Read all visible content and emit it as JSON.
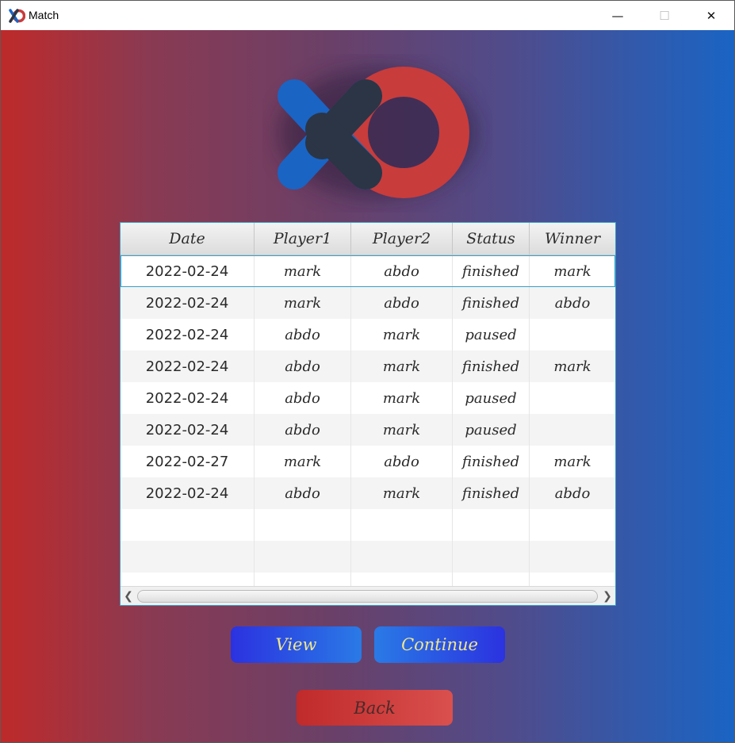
{
  "window": {
    "title": "Match",
    "minimize_glyph": "—",
    "maximize_glyph": "☐",
    "close_glyph": "✕"
  },
  "colors": {
    "gradient_left": "#be2a2a",
    "gradient_right": "#1a64c4",
    "logo_x_blue": "#1a64c4",
    "logo_x_dark": "#2b3545",
    "logo_o_red": "#c83c3c",
    "button_text": "#f0e68a"
  },
  "table": {
    "headers": [
      "Date",
      "Player1",
      "Player2",
      "Status",
      "Winner"
    ],
    "rows": [
      [
        "2022-02-24",
        "mark",
        "abdo",
        "finished",
        "mark"
      ],
      [
        "2022-02-24",
        "mark",
        "abdo",
        "finished",
        "abdo"
      ],
      [
        "2022-02-24",
        "abdo",
        "mark",
        "paused",
        ""
      ],
      [
        "2022-02-24",
        "abdo",
        "mark",
        "finished",
        "mark"
      ],
      [
        "2022-02-24",
        "abdo",
        "mark",
        "paused",
        ""
      ],
      [
        "2022-02-24",
        "abdo",
        "mark",
        "paused",
        ""
      ],
      [
        "2022-02-27",
        "mark",
        "abdo",
        "finished",
        "mark"
      ],
      [
        "2022-02-24",
        "abdo",
        "mark",
        "finished",
        "abdo"
      ],
      [
        "",
        "",
        "",
        "",
        ""
      ],
      [
        "",
        "",
        "",
        "",
        ""
      ],
      [
        "",
        "",
        "",
        "",
        ""
      ]
    ],
    "selected_row": 0
  },
  "scrollbar": {
    "left_arrow": "❮",
    "right_arrow": "❯"
  },
  "buttons": {
    "view": "View",
    "continue": "Continue",
    "back": "Back"
  }
}
